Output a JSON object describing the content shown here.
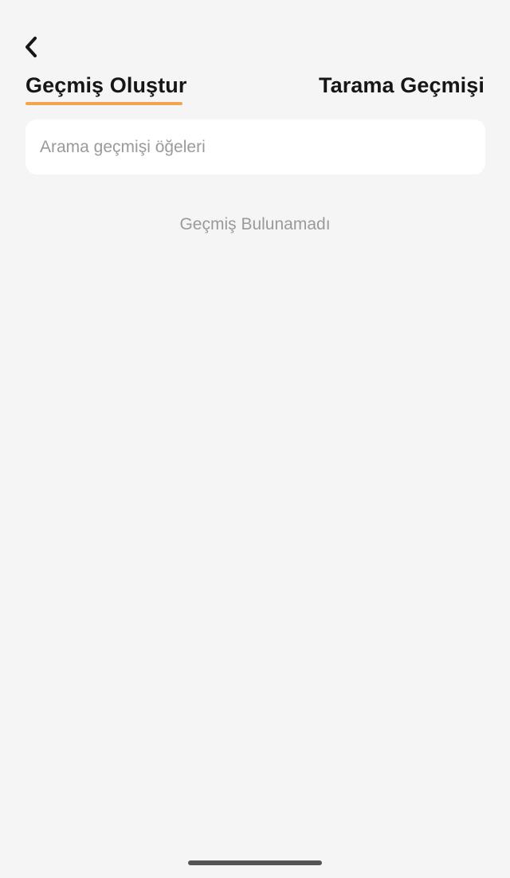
{
  "header": {
    "back_icon": "chevron-left-icon"
  },
  "tabs": [
    {
      "label": "Geçmiş Oluştur",
      "active": true
    },
    {
      "label": "Tarama Geçmişi",
      "active": false
    }
  ],
  "search": {
    "value": "",
    "placeholder": "Arama geçmişi öğeleri"
  },
  "empty_state": {
    "message": "Geçmiş Bulunamadı"
  },
  "colors": {
    "background": "#f5f5f5",
    "accent": "#f3a450",
    "text_primary": "#161616",
    "text_muted": "#9a9a9a"
  }
}
